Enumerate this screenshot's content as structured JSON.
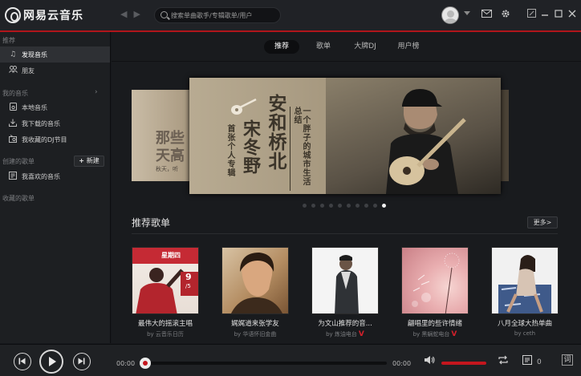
{
  "app": {
    "title": "网易云音乐"
  },
  "search": {
    "placeholder": "搜索单曲歌手/专辑歌单/用户"
  },
  "sidebar": {
    "section_recommend": "推荐",
    "section_my_music": "我的音乐",
    "section_created": "创建的歌单",
    "section_collected": "收藏的歌单",
    "new_label": "新建",
    "items": [
      {
        "label": "发现音乐",
        "icon": "music-note-icon"
      },
      {
        "label": "朋友",
        "icon": "friends-icon"
      },
      {
        "label": "本地音乐",
        "icon": "local-music-icon"
      },
      {
        "label": "我下载的音乐",
        "icon": "download-icon"
      },
      {
        "label": "我收藏的DJ节目",
        "icon": "radio-icon"
      },
      {
        "label": "我喜欢的音乐",
        "icon": "playlist-icon"
      }
    ]
  },
  "tabs": [
    {
      "label": "推荐"
    },
    {
      "label": "歌单"
    },
    {
      "label": "大牌DJ"
    },
    {
      "label": "用户榜"
    }
  ],
  "banner": {
    "title_main": "安和桥北",
    "artist": "宋冬野",
    "subtitle": "首张个人专辑",
    "tagline": "一个胖子的城市生活总结",
    "side_left_text": "那些天高",
    "side_left_caption": "秋天，听",
    "dots_total": 10,
    "active_dot": 9
  },
  "recommended": {
    "title": "推荐歌单",
    "more_label": "更多>",
    "cover1_day": "星期四",
    "cover1_date": "9",
    "cover1_month": "/5",
    "playlists": [
      {
        "name": "最伟大的摇滚主唱",
        "by": "by  云音乐日历",
        "verified": false
      },
      {
        "name": "娓娓道来张学友",
        "by": "by  华语怀旧金曲",
        "verified": false
      },
      {
        "name": "为文山推荐的音...",
        "by": "by  炼油电台",
        "verified": true
      },
      {
        "name": "翩唱里的些许情绪",
        "by": "by  黑蜗蛇电台",
        "verified": true
      },
      {
        "name": "八月全球大热单曲",
        "by": "by  ceth",
        "verified": false
      }
    ]
  },
  "player": {
    "elapsed": "00:00",
    "total": "00:00",
    "progress_fraction": 0.0,
    "volume_fraction": 1.0,
    "queue_count": "0"
  },
  "colors": {
    "accent": "#c4161e",
    "titlebar": "#202226",
    "background": "#191b1e"
  }
}
